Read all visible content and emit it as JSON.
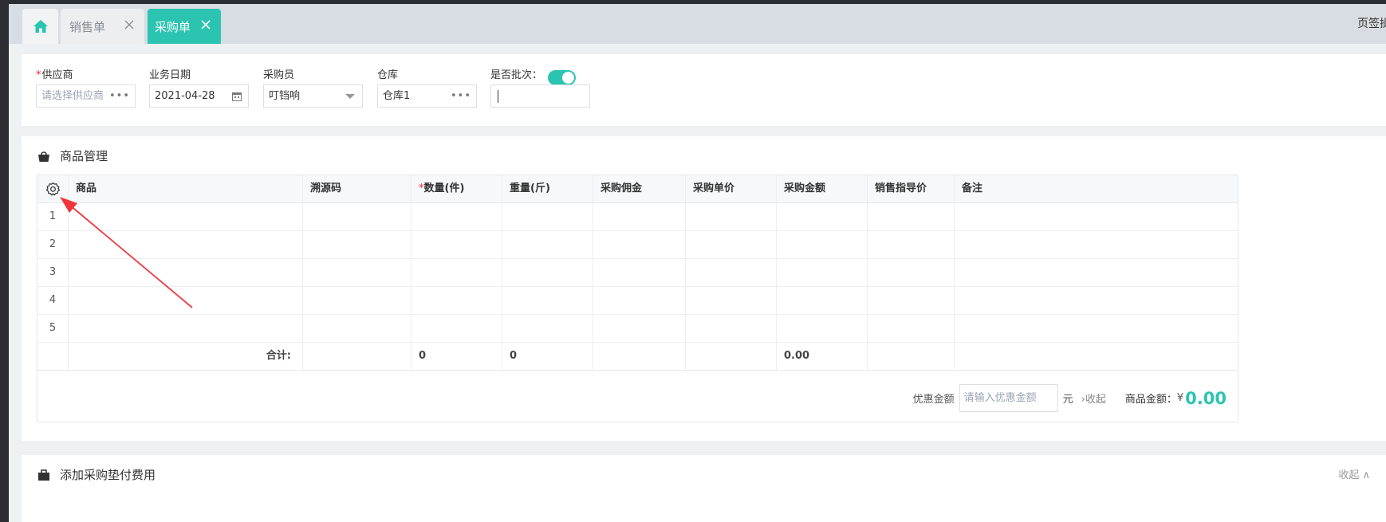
{
  "tabs": {
    "home_icon": "home-icon",
    "sales_label": "销售单",
    "purchase_label": "采购单",
    "right_text": "页签操"
  },
  "form": {
    "supplier": {
      "label": "供应商",
      "placeholder": "请选择供应商",
      "suffix": "•••"
    },
    "date": {
      "label": "业务日期",
      "value": "2021-04-28"
    },
    "buyer": {
      "label": "采购员",
      "value": "叮铛响"
    },
    "warehouse": {
      "label": "仓库",
      "value": "仓库1",
      "suffix": "•••"
    },
    "batch": {
      "label": "是否批次：",
      "enabled": true
    }
  },
  "goods": {
    "section_title": "商品管理",
    "columns": [
      "商品",
      "溯源码",
      "数量(件)",
      "重量(斤)",
      "采购佣金",
      "采购单价",
      "采购金额",
      "销售指导价",
      "备注"
    ],
    "rows": [
      "1",
      "2",
      "3",
      "4",
      "5"
    ],
    "totals": {
      "label": "合计:",
      "quantity": "0",
      "weight": "0",
      "amount": "0.00"
    },
    "discount": {
      "label": "优惠金额",
      "placeholder": "请输入优惠金额",
      "unit": "元",
      "collapse": "收起",
      "sum_label": "商品金额：",
      "currency": "¥",
      "sum_value": "0.00"
    }
  },
  "fee": {
    "section_title": "添加采购垫付费用",
    "right_text": "收起 ∧"
  },
  "colors": {
    "accent": "#2bc4b1",
    "required": "#f5222d",
    "arrow": "#f0363c"
  }
}
